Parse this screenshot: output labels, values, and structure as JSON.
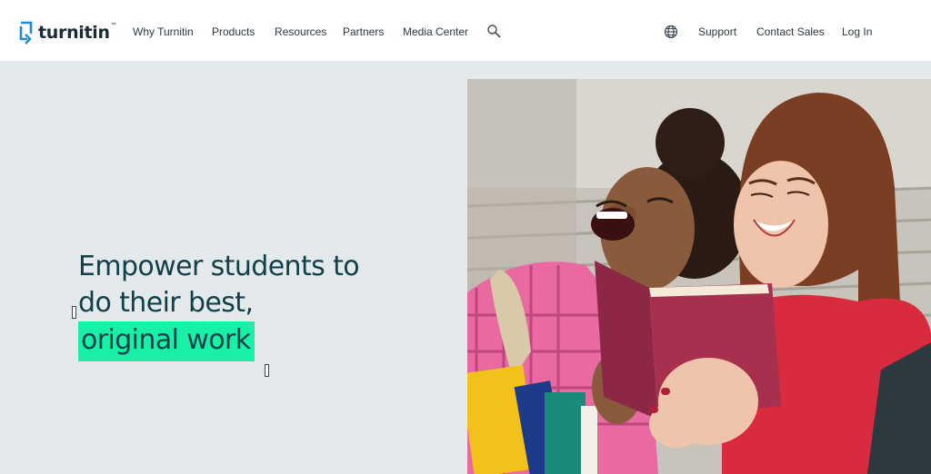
{
  "brand": {
    "name": "turnitin",
    "tm": "™"
  },
  "nav": {
    "primary": [
      "Why Turnitin",
      "Products",
      "Resources",
      "Partners",
      "Media Center"
    ],
    "secondary": [
      "Support",
      "Contact Sales",
      "Log In"
    ],
    "icons": [
      "search-icon",
      "globe-icon"
    ]
  },
  "hero": {
    "line1": "Empower students to",
    "line2": "do their best,",
    "highlight": "original work",
    "image": "two laughing students reading a red book on stone steps"
  },
  "colors": {
    "brand_blue": "#1f8ad3",
    "heading": "#10404a",
    "highlight": "#18f0a8",
    "hero_bg": "#e4e9ec",
    "nav_bg": "#ffffff"
  }
}
